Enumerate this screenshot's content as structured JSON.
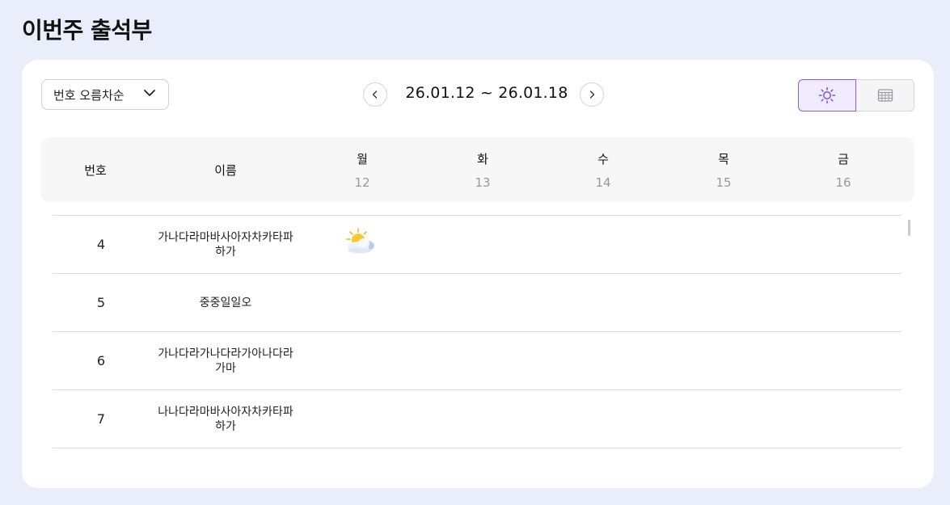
{
  "page": {
    "title": "이번주 출석부"
  },
  "toolbar": {
    "sort_label": "번호 오름차순",
    "week_range": "26.01.12 ~ 26.01.18",
    "view_modes": [
      "weather-icon",
      "calendar-grid-icon"
    ],
    "active_view": "weather-icon",
    "accent_color": "#8a5cf0"
  },
  "table": {
    "headers": {
      "number": "번호",
      "name": "이름"
    },
    "days": [
      {
        "day": "월",
        "date": "12"
      },
      {
        "day": "화",
        "date": "13"
      },
      {
        "day": "수",
        "date": "14"
      },
      {
        "day": "목",
        "date": "15"
      },
      {
        "day": "금",
        "date": "16"
      }
    ],
    "rows": [
      {
        "number": "4",
        "name": "가나다라마바사아자차카타파하가",
        "marks": [
          "sun-behind-cloud-icon",
          "",
          "",
          "",
          ""
        ]
      },
      {
        "number": "5",
        "name": "중중일일오",
        "marks": [
          "",
          "",
          "",
          "",
          ""
        ]
      },
      {
        "number": "6",
        "name": "가나다라가나다라가아나다라가마",
        "marks": [
          "",
          "",
          "",
          "",
          ""
        ]
      },
      {
        "number": "7",
        "name": "나나다라마바사아자차카타파하가",
        "marks": [
          "",
          "",
          "",
          "",
          ""
        ]
      }
    ]
  }
}
